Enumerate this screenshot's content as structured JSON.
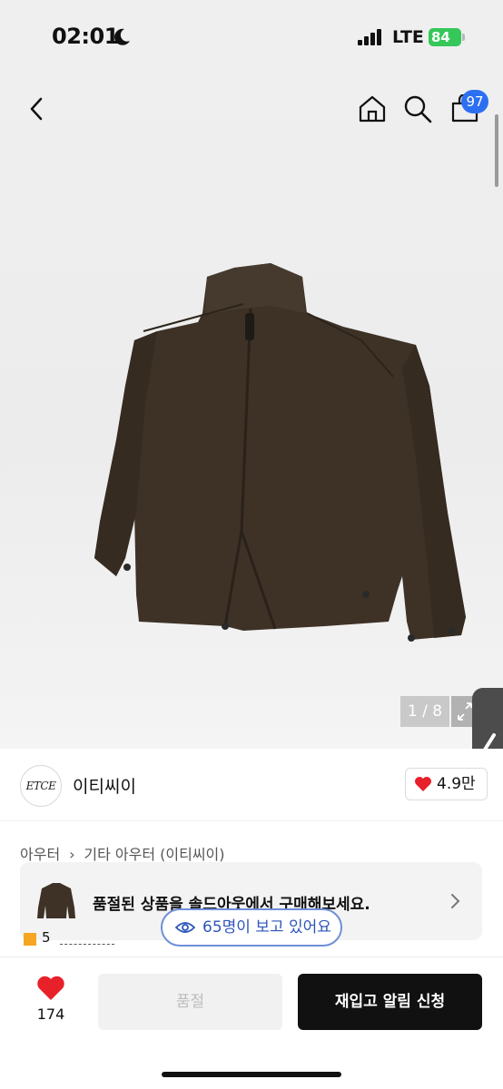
{
  "status_bar": {
    "time": "02:01",
    "network": "LTE",
    "battery": "84"
  },
  "nav": {
    "cart_count": "97"
  },
  "gallery": {
    "counter": "1 / 8"
  },
  "seller": {
    "logo_text": "ETCE",
    "name": "이티씨이",
    "likes": "4.9만"
  },
  "breadcrumb": {
    "level1": "아우터",
    "level2": "기타 아우터",
    "level3": "(이티씨이)"
  },
  "soldout_banner": {
    "text": "품절된 상품을 솔드아웃에서 구매해보세요."
  },
  "rating_partial": {
    "value": "5"
  },
  "viewers": {
    "text": "65명이 보고 있어요"
  },
  "bottom_bar": {
    "wish_count": "174",
    "soldout_label": "품절",
    "restock_label": "재입고 알림 신청"
  },
  "colors": {
    "accent_blue": "#2c6ff1",
    "heart_red": "#e8202a",
    "battery_green": "#35c759",
    "primary_button": "#111111"
  }
}
